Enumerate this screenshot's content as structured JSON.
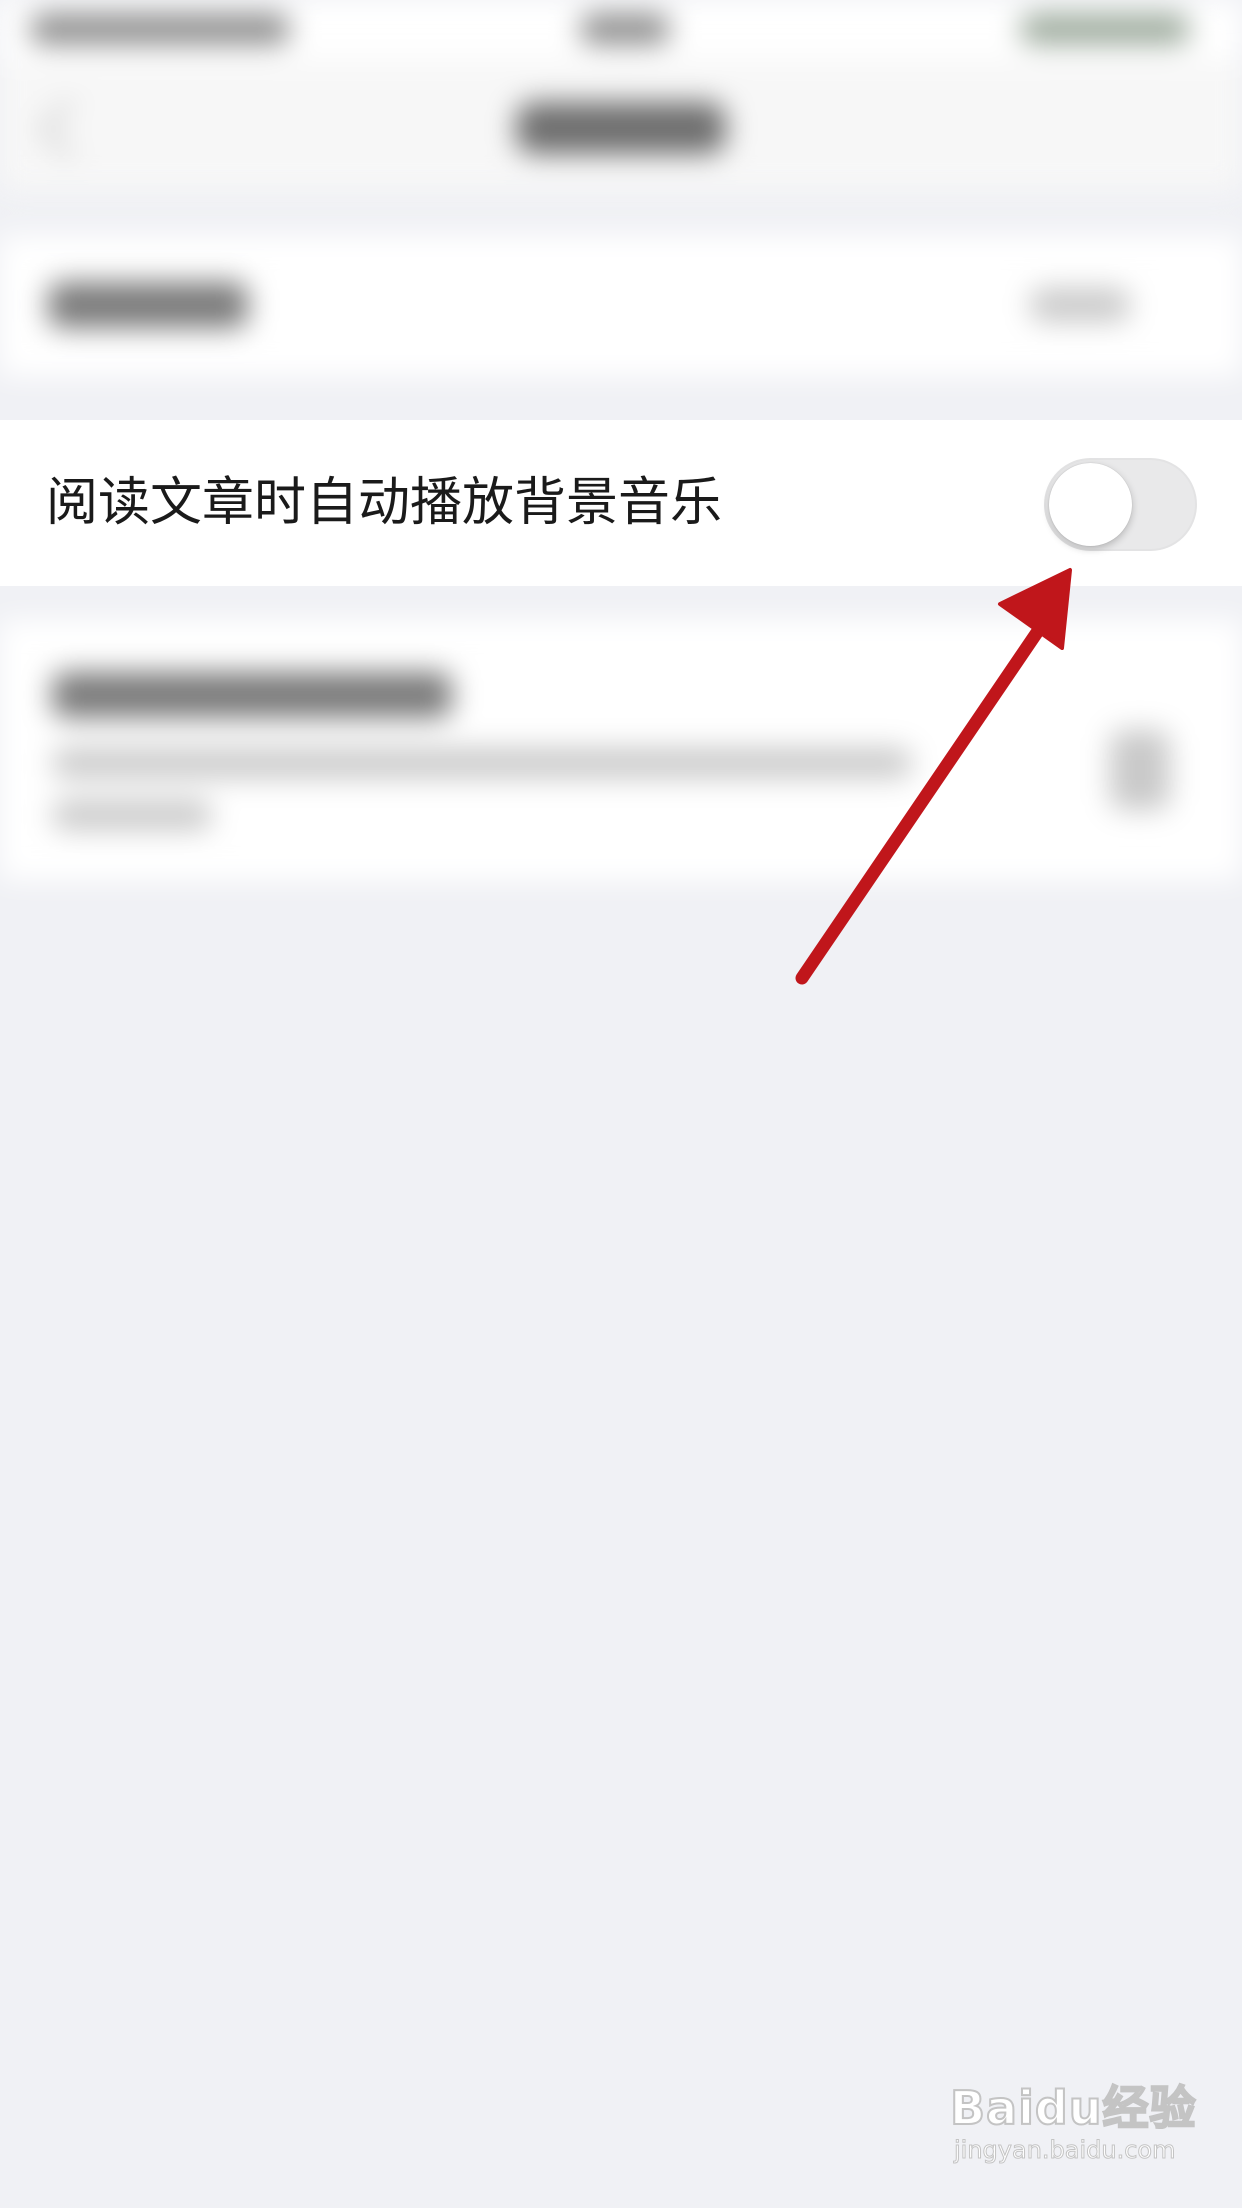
{
  "setting": {
    "label": "阅读文章时自动播放背景音乐",
    "toggle_state": "off"
  },
  "annotation": {
    "arrow_color": "#c0161b"
  },
  "watermark": {
    "logo": "Baidu经验",
    "url": "jingyan.baidu.com"
  },
  "colors": {
    "background": "#f0f1f5",
    "row_background": "#ffffff",
    "toggle_off": "#e9e9ea"
  }
}
